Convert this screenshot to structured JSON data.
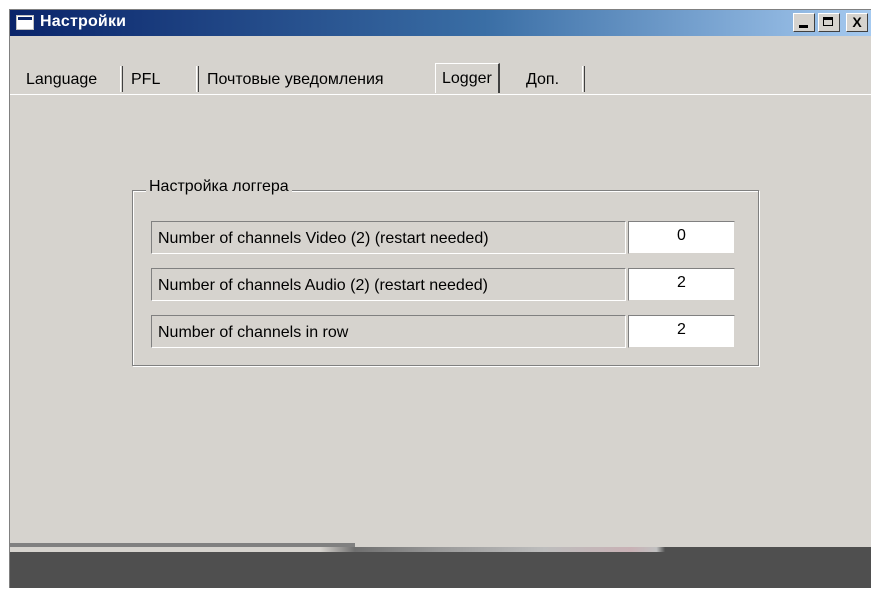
{
  "window": {
    "title": "Настройки",
    "controls": {
      "minimize_icon": "minimize-icon",
      "maximize_icon": "maximize-icon",
      "close_glyph": "X"
    }
  },
  "tabs": [
    {
      "label": "Language",
      "active": false
    },
    {
      "label": "PFL",
      "active": false
    },
    {
      "label": "Почтовые уведомления",
      "active": false
    },
    {
      "label": "Logger",
      "active": true
    },
    {
      "label": "Доп.",
      "active": false
    }
  ],
  "logger_group": {
    "title": "Настройка логгера",
    "rows": [
      {
        "label": "Number of channels Video (2) (restart needed)",
        "value": "0"
      },
      {
        "label": "Number of channels Audio (2) (restart needed)",
        "value": "2"
      },
      {
        "label": "Number of channels in row",
        "value": "2"
      }
    ]
  },
  "colors": {
    "titlebar_start": "#0a246a",
    "titlebar_end": "#a6caf0",
    "face": "#d6d3ce"
  }
}
